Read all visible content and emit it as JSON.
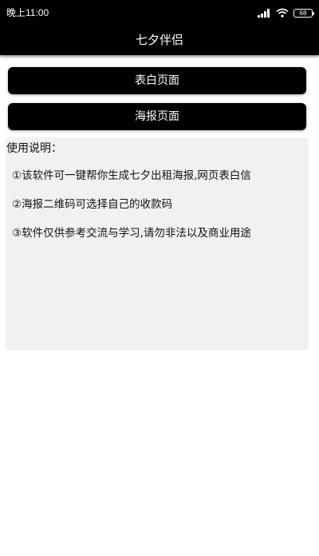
{
  "status_bar": {
    "time": "晚上11:00",
    "battery": "68",
    "icons": [
      "signal-icon",
      "wifi-icon",
      "battery-icon"
    ]
  },
  "app_bar": {
    "title": "七夕伴侣"
  },
  "buttons": {
    "confession_page": "表白页面",
    "poster_page": "海报页面"
  },
  "usage": {
    "heading": "使用说明：",
    "items": [
      "①该软件可一键帮你生成七夕出租海报,网页表白信",
      "②海报二维码可选择自己的收款码",
      "③软件仅供参考交流与学习,请勿非法以及商业用途"
    ]
  },
  "colors": {
    "bar_background": "#000000",
    "button_background": "#000000",
    "panel_background": "#f1f1f1",
    "text_on_dark": "#ffffff"
  }
}
